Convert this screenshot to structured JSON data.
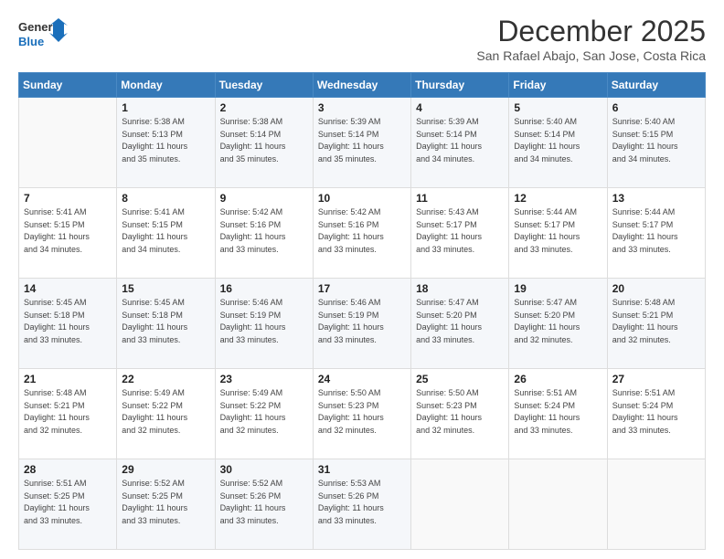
{
  "header": {
    "logo_line1": "General",
    "logo_line2": "Blue",
    "title": "December 2025",
    "subtitle": "San Rafael Abajo, San Jose, Costa Rica"
  },
  "calendar": {
    "days_of_week": [
      "Sunday",
      "Monday",
      "Tuesday",
      "Wednesday",
      "Thursday",
      "Friday",
      "Saturday"
    ],
    "weeks": [
      [
        {
          "day": "",
          "info": ""
        },
        {
          "day": "1",
          "info": "Sunrise: 5:38 AM\nSunset: 5:13 PM\nDaylight: 11 hours\nand 35 minutes."
        },
        {
          "day": "2",
          "info": "Sunrise: 5:38 AM\nSunset: 5:14 PM\nDaylight: 11 hours\nand 35 minutes."
        },
        {
          "day": "3",
          "info": "Sunrise: 5:39 AM\nSunset: 5:14 PM\nDaylight: 11 hours\nand 35 minutes."
        },
        {
          "day": "4",
          "info": "Sunrise: 5:39 AM\nSunset: 5:14 PM\nDaylight: 11 hours\nand 34 minutes."
        },
        {
          "day": "5",
          "info": "Sunrise: 5:40 AM\nSunset: 5:14 PM\nDaylight: 11 hours\nand 34 minutes."
        },
        {
          "day": "6",
          "info": "Sunrise: 5:40 AM\nSunset: 5:15 PM\nDaylight: 11 hours\nand 34 minutes."
        }
      ],
      [
        {
          "day": "7",
          "info": "Sunrise: 5:41 AM\nSunset: 5:15 PM\nDaylight: 11 hours\nand 34 minutes."
        },
        {
          "day": "8",
          "info": "Sunrise: 5:41 AM\nSunset: 5:15 PM\nDaylight: 11 hours\nand 34 minutes."
        },
        {
          "day": "9",
          "info": "Sunrise: 5:42 AM\nSunset: 5:16 PM\nDaylight: 11 hours\nand 33 minutes."
        },
        {
          "day": "10",
          "info": "Sunrise: 5:42 AM\nSunset: 5:16 PM\nDaylight: 11 hours\nand 33 minutes."
        },
        {
          "day": "11",
          "info": "Sunrise: 5:43 AM\nSunset: 5:17 PM\nDaylight: 11 hours\nand 33 minutes."
        },
        {
          "day": "12",
          "info": "Sunrise: 5:44 AM\nSunset: 5:17 PM\nDaylight: 11 hours\nand 33 minutes."
        },
        {
          "day": "13",
          "info": "Sunrise: 5:44 AM\nSunset: 5:17 PM\nDaylight: 11 hours\nand 33 minutes."
        }
      ],
      [
        {
          "day": "14",
          "info": "Sunrise: 5:45 AM\nSunset: 5:18 PM\nDaylight: 11 hours\nand 33 minutes."
        },
        {
          "day": "15",
          "info": "Sunrise: 5:45 AM\nSunset: 5:18 PM\nDaylight: 11 hours\nand 33 minutes."
        },
        {
          "day": "16",
          "info": "Sunrise: 5:46 AM\nSunset: 5:19 PM\nDaylight: 11 hours\nand 33 minutes."
        },
        {
          "day": "17",
          "info": "Sunrise: 5:46 AM\nSunset: 5:19 PM\nDaylight: 11 hours\nand 33 minutes."
        },
        {
          "day": "18",
          "info": "Sunrise: 5:47 AM\nSunset: 5:20 PM\nDaylight: 11 hours\nand 33 minutes."
        },
        {
          "day": "19",
          "info": "Sunrise: 5:47 AM\nSunset: 5:20 PM\nDaylight: 11 hours\nand 32 minutes."
        },
        {
          "day": "20",
          "info": "Sunrise: 5:48 AM\nSunset: 5:21 PM\nDaylight: 11 hours\nand 32 minutes."
        }
      ],
      [
        {
          "day": "21",
          "info": "Sunrise: 5:48 AM\nSunset: 5:21 PM\nDaylight: 11 hours\nand 32 minutes."
        },
        {
          "day": "22",
          "info": "Sunrise: 5:49 AM\nSunset: 5:22 PM\nDaylight: 11 hours\nand 32 minutes."
        },
        {
          "day": "23",
          "info": "Sunrise: 5:49 AM\nSunset: 5:22 PM\nDaylight: 11 hours\nand 32 minutes."
        },
        {
          "day": "24",
          "info": "Sunrise: 5:50 AM\nSunset: 5:23 PM\nDaylight: 11 hours\nand 32 minutes."
        },
        {
          "day": "25",
          "info": "Sunrise: 5:50 AM\nSunset: 5:23 PM\nDaylight: 11 hours\nand 32 minutes."
        },
        {
          "day": "26",
          "info": "Sunrise: 5:51 AM\nSunset: 5:24 PM\nDaylight: 11 hours\nand 33 minutes."
        },
        {
          "day": "27",
          "info": "Sunrise: 5:51 AM\nSunset: 5:24 PM\nDaylight: 11 hours\nand 33 minutes."
        }
      ],
      [
        {
          "day": "28",
          "info": "Sunrise: 5:51 AM\nSunset: 5:25 PM\nDaylight: 11 hours\nand 33 minutes."
        },
        {
          "day": "29",
          "info": "Sunrise: 5:52 AM\nSunset: 5:25 PM\nDaylight: 11 hours\nand 33 minutes."
        },
        {
          "day": "30",
          "info": "Sunrise: 5:52 AM\nSunset: 5:26 PM\nDaylight: 11 hours\nand 33 minutes."
        },
        {
          "day": "31",
          "info": "Sunrise: 5:53 AM\nSunset: 5:26 PM\nDaylight: 11 hours\nand 33 minutes."
        },
        {
          "day": "",
          "info": ""
        },
        {
          "day": "",
          "info": ""
        },
        {
          "day": "",
          "info": ""
        }
      ]
    ]
  }
}
